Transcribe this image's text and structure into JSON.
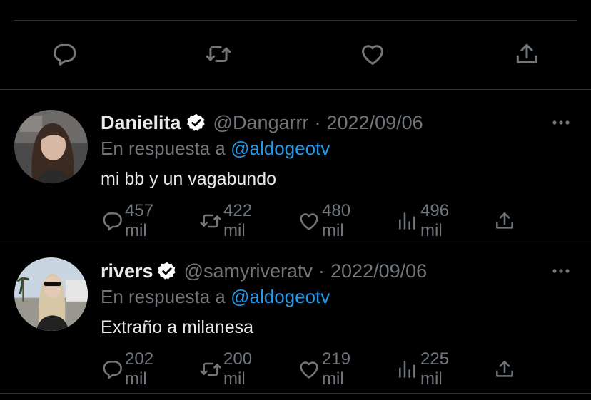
{
  "action_bar": {
    "icons": [
      "reply-icon",
      "retweet-icon",
      "like-icon",
      "share-icon"
    ]
  },
  "reply_prefix": "En respuesta a",
  "tweets": [
    {
      "name": "Danielita",
      "handle": "@Dangarrr",
      "separator": "·",
      "date": "2022/09/06",
      "reply_to": "@aldogeotv",
      "text": "mi bb y un vagabundo",
      "replies": "457 mil",
      "retweets": "422 mil",
      "likes": "480 mil",
      "views": "496 mil"
    },
    {
      "name": "rivers",
      "handle": "@samyriveratv",
      "separator": "·",
      "date": "2022/09/06",
      "reply_to": "@aldogeotv",
      "text": "Extraño a milanesa",
      "replies": "202 mil",
      "retweets": "200 mil",
      "likes": "219 mil",
      "views": "225 mil"
    }
  ],
  "colors": {
    "background": "#000000",
    "text": "#e7e9ea",
    "muted": "#71767b",
    "link": "#1d9bf0",
    "divider": "#2f3336"
  }
}
